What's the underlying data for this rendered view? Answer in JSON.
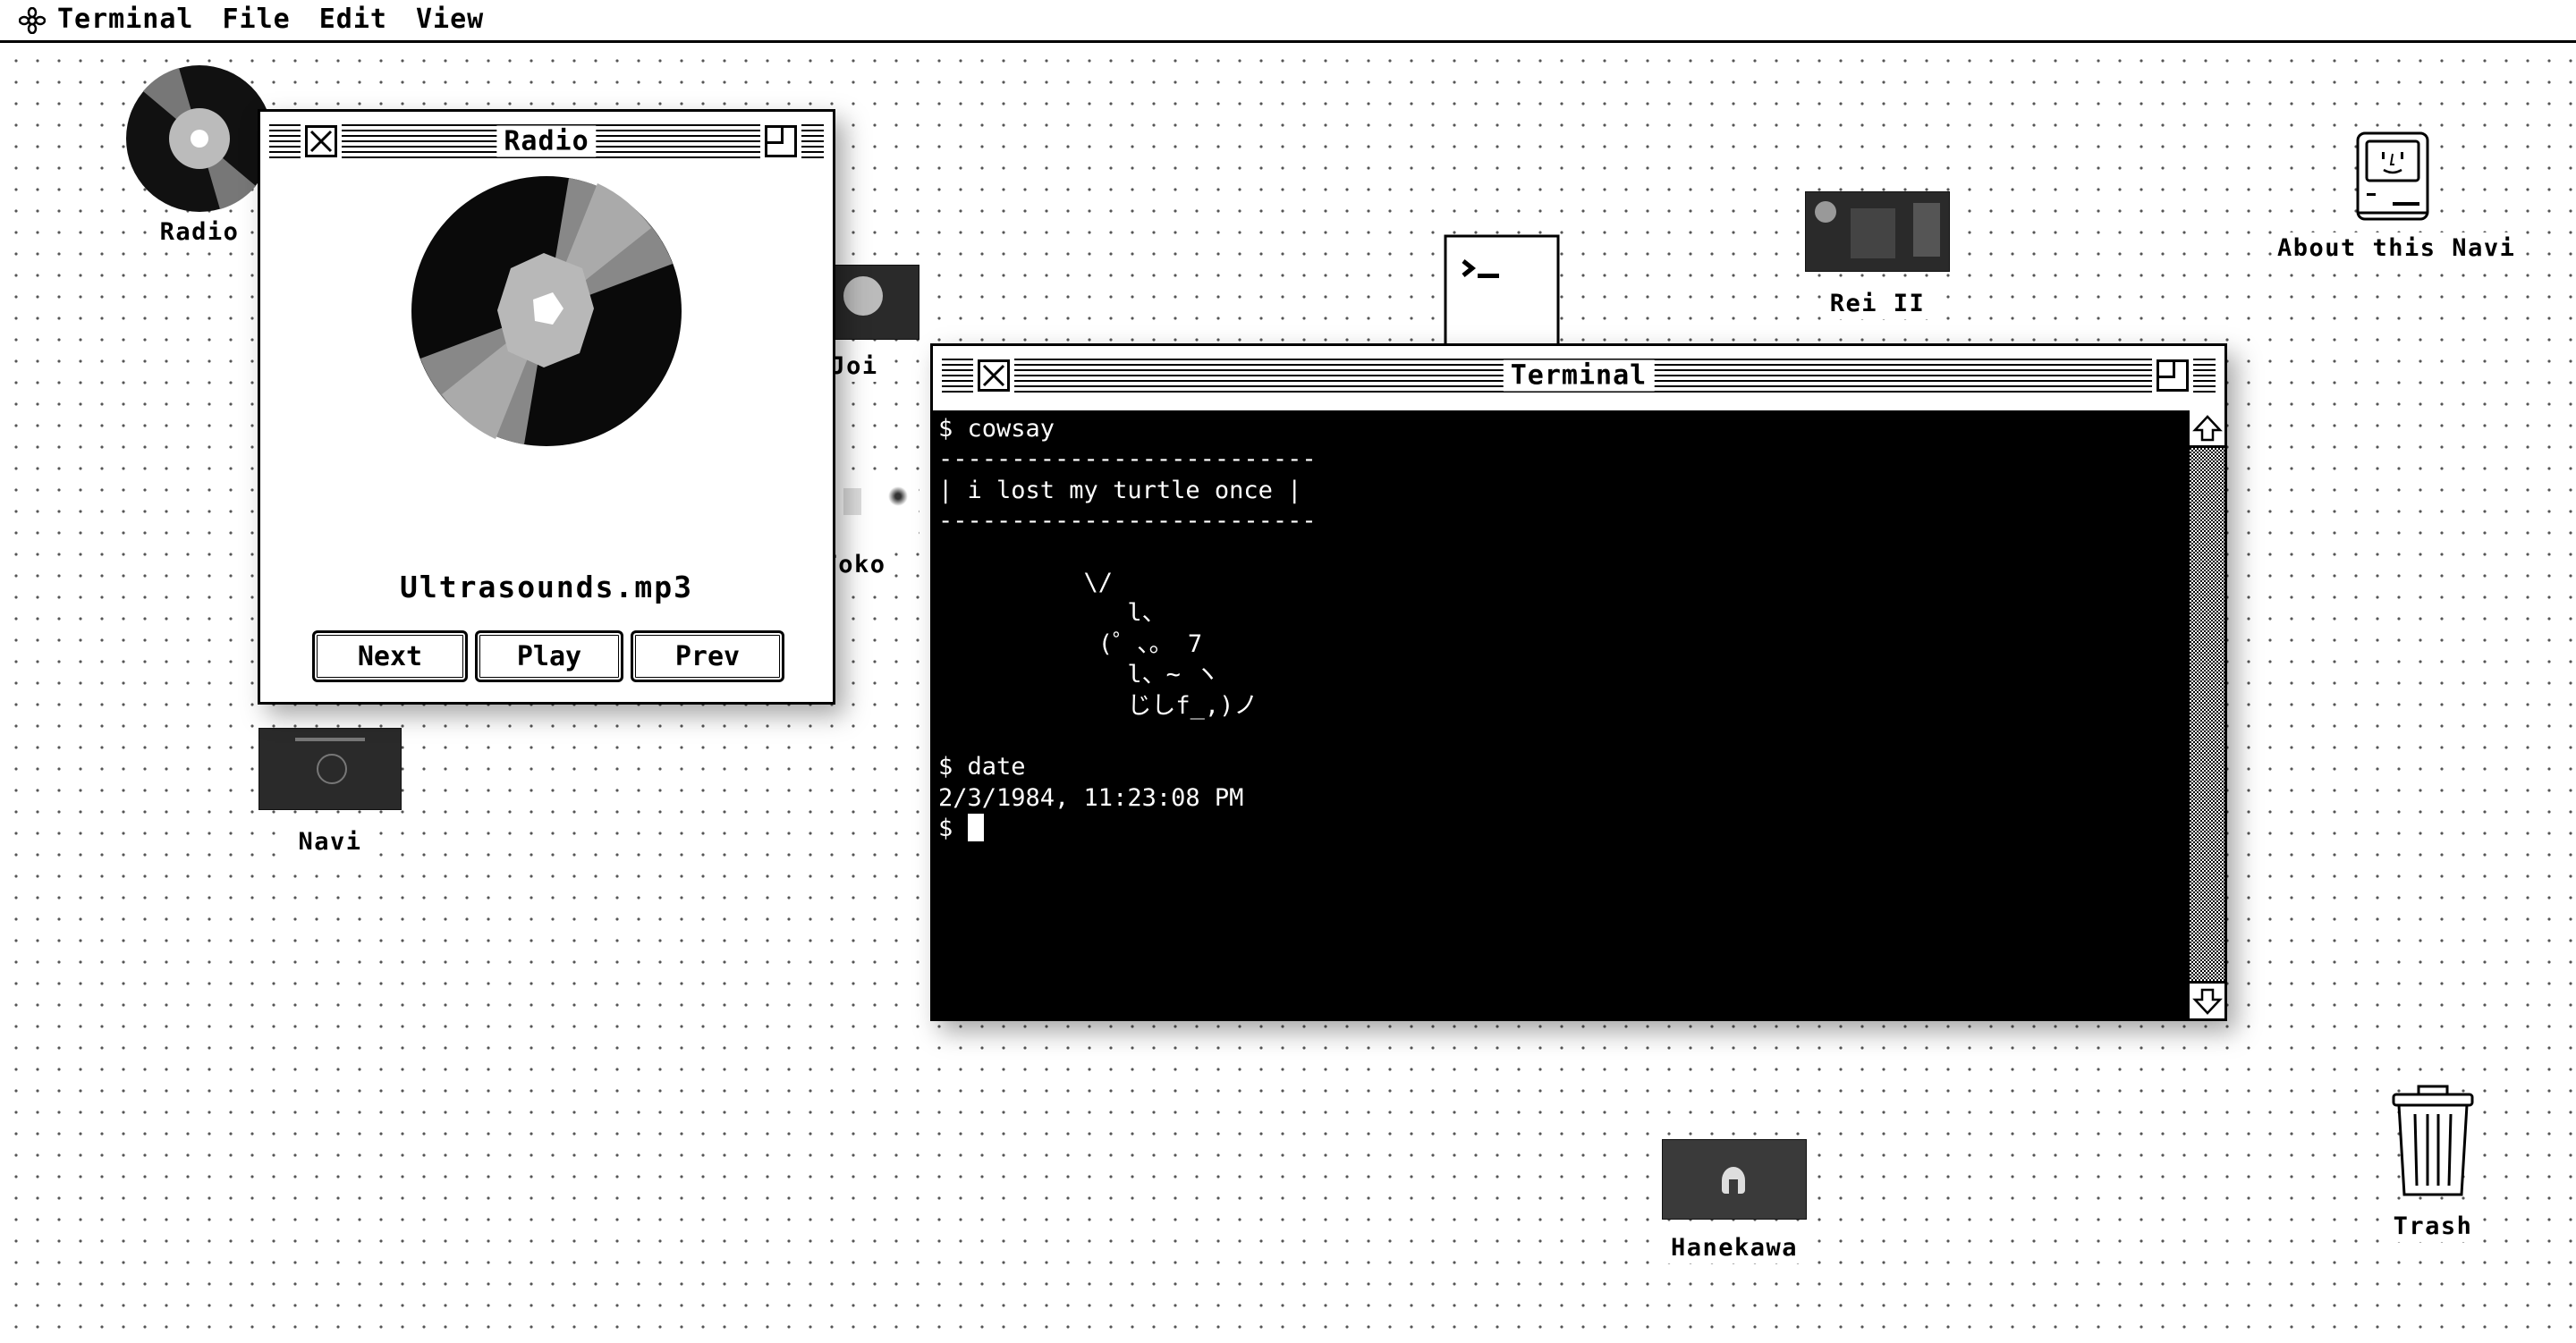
{
  "menubar": {
    "app_icon": "flower-logo-icon",
    "app_name": "Terminal",
    "items": [
      "File",
      "Edit",
      "View"
    ]
  },
  "desktop": {
    "icons": [
      {
        "id": "radio",
        "label": "Radio",
        "icon": "vinyl-record-icon"
      },
      {
        "id": "joi",
        "label": "Joi",
        "icon": "image-thumbnail"
      },
      {
        "id": "toko",
        "label": "Toko",
        "icon": "image-thumbnail"
      },
      {
        "id": "navi",
        "label": "Navi",
        "icon": "image-thumbnail"
      },
      {
        "id": "terminal",
        "label": "",
        "icon": "terminal-app-icon"
      },
      {
        "id": "rei",
        "label": "Rei II",
        "icon": "image-thumbnail"
      },
      {
        "id": "about",
        "label": "About this Navi",
        "icon": "classic-mac-icon"
      },
      {
        "id": "hanekawa",
        "label": "Hanekawa",
        "icon": "image-thumbnail"
      },
      {
        "id": "trash",
        "label": "Trash",
        "icon": "trash-can-icon"
      }
    ]
  },
  "radio_window": {
    "title": "Radio",
    "track": "Ultrasounds.mp3",
    "buttons": {
      "next": "Next",
      "play": "Play",
      "prev": "Prev"
    }
  },
  "terminal_window": {
    "title": "Terminal",
    "output": "$ cowsay\n--------------------------\n| i lost my turtle once |\n--------------------------\n\n          \\/\n             l、\n           (゜、。 7\n             l、~ ヽ\n             じしf_,)ノ\n\n$ date\n2/3/1984, 11:23:08 PM\n$ "
  },
  "colors": {
    "foreground": "#000000",
    "background": "#ffffff",
    "terminal_bg": "#000000",
    "terminal_fg": "#ffffff"
  }
}
